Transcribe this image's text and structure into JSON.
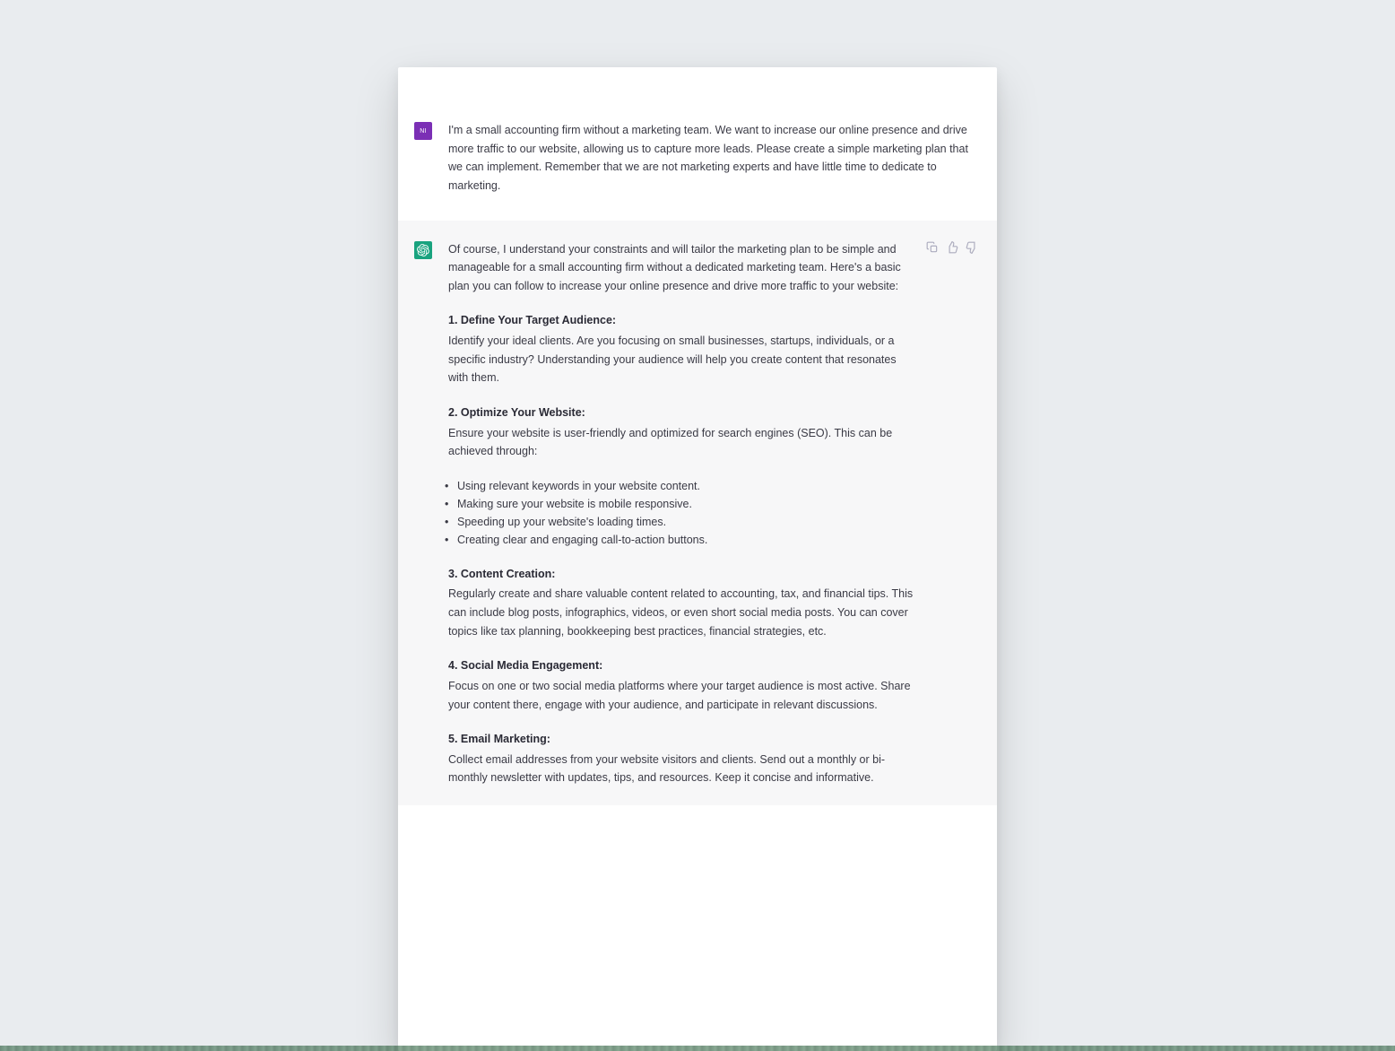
{
  "user": {
    "avatar_initials": "NI",
    "message": "I'm a small accounting firm without a marketing team. We want to increase our online presence and drive more traffic to our website, allowing us to capture more leads. Please create a simple marketing plan that we can implement. Remember that we are not marketing experts and have little time to dedicate to marketing."
  },
  "assistant": {
    "intro": "Of course, I understand your constraints and will tailor the marketing plan to be simple and manageable for a small accounting firm without a dedicated marketing team. Here's a basic plan you can follow to increase your online presence and drive more traffic to your website:",
    "sections": [
      {
        "heading": "1. Define Your Target Audience:",
        "body": "Identify your ideal clients. Are you focusing on small businesses, startups, individuals, or a specific industry? Understanding your audience will help you create content that resonates with them."
      },
      {
        "heading": "2. Optimize Your Website:",
        "body": "Ensure your website is user-friendly and optimized for search engines (SEO). This can be achieved through:"
      }
    ],
    "bullets": [
      "Using relevant keywords in your website content.",
      "Making sure your website is mobile responsive.",
      "Speeding up your website's loading times.",
      "Creating clear and engaging call-to-action buttons."
    ],
    "sections2": [
      {
        "heading": "3. Content Creation:",
        "body": "Regularly create and share valuable content related to accounting, tax, and financial tips. This can include blog posts, infographics, videos, or even short social media posts. You can cover topics like tax planning, bookkeeping best practices, financial strategies, etc."
      },
      {
        "heading": "4. Social Media Engagement:",
        "body": "Focus on one or two social media platforms where your target audience is most active. Share your content there, engage with your audience, and participate in relevant discussions."
      },
      {
        "heading": "5. Email Marketing:",
        "body": "Collect email addresses from your website visitors and clients. Send out a monthly or bi-monthly newsletter with updates, tips, and resources. Keep it concise and informative."
      }
    ]
  }
}
